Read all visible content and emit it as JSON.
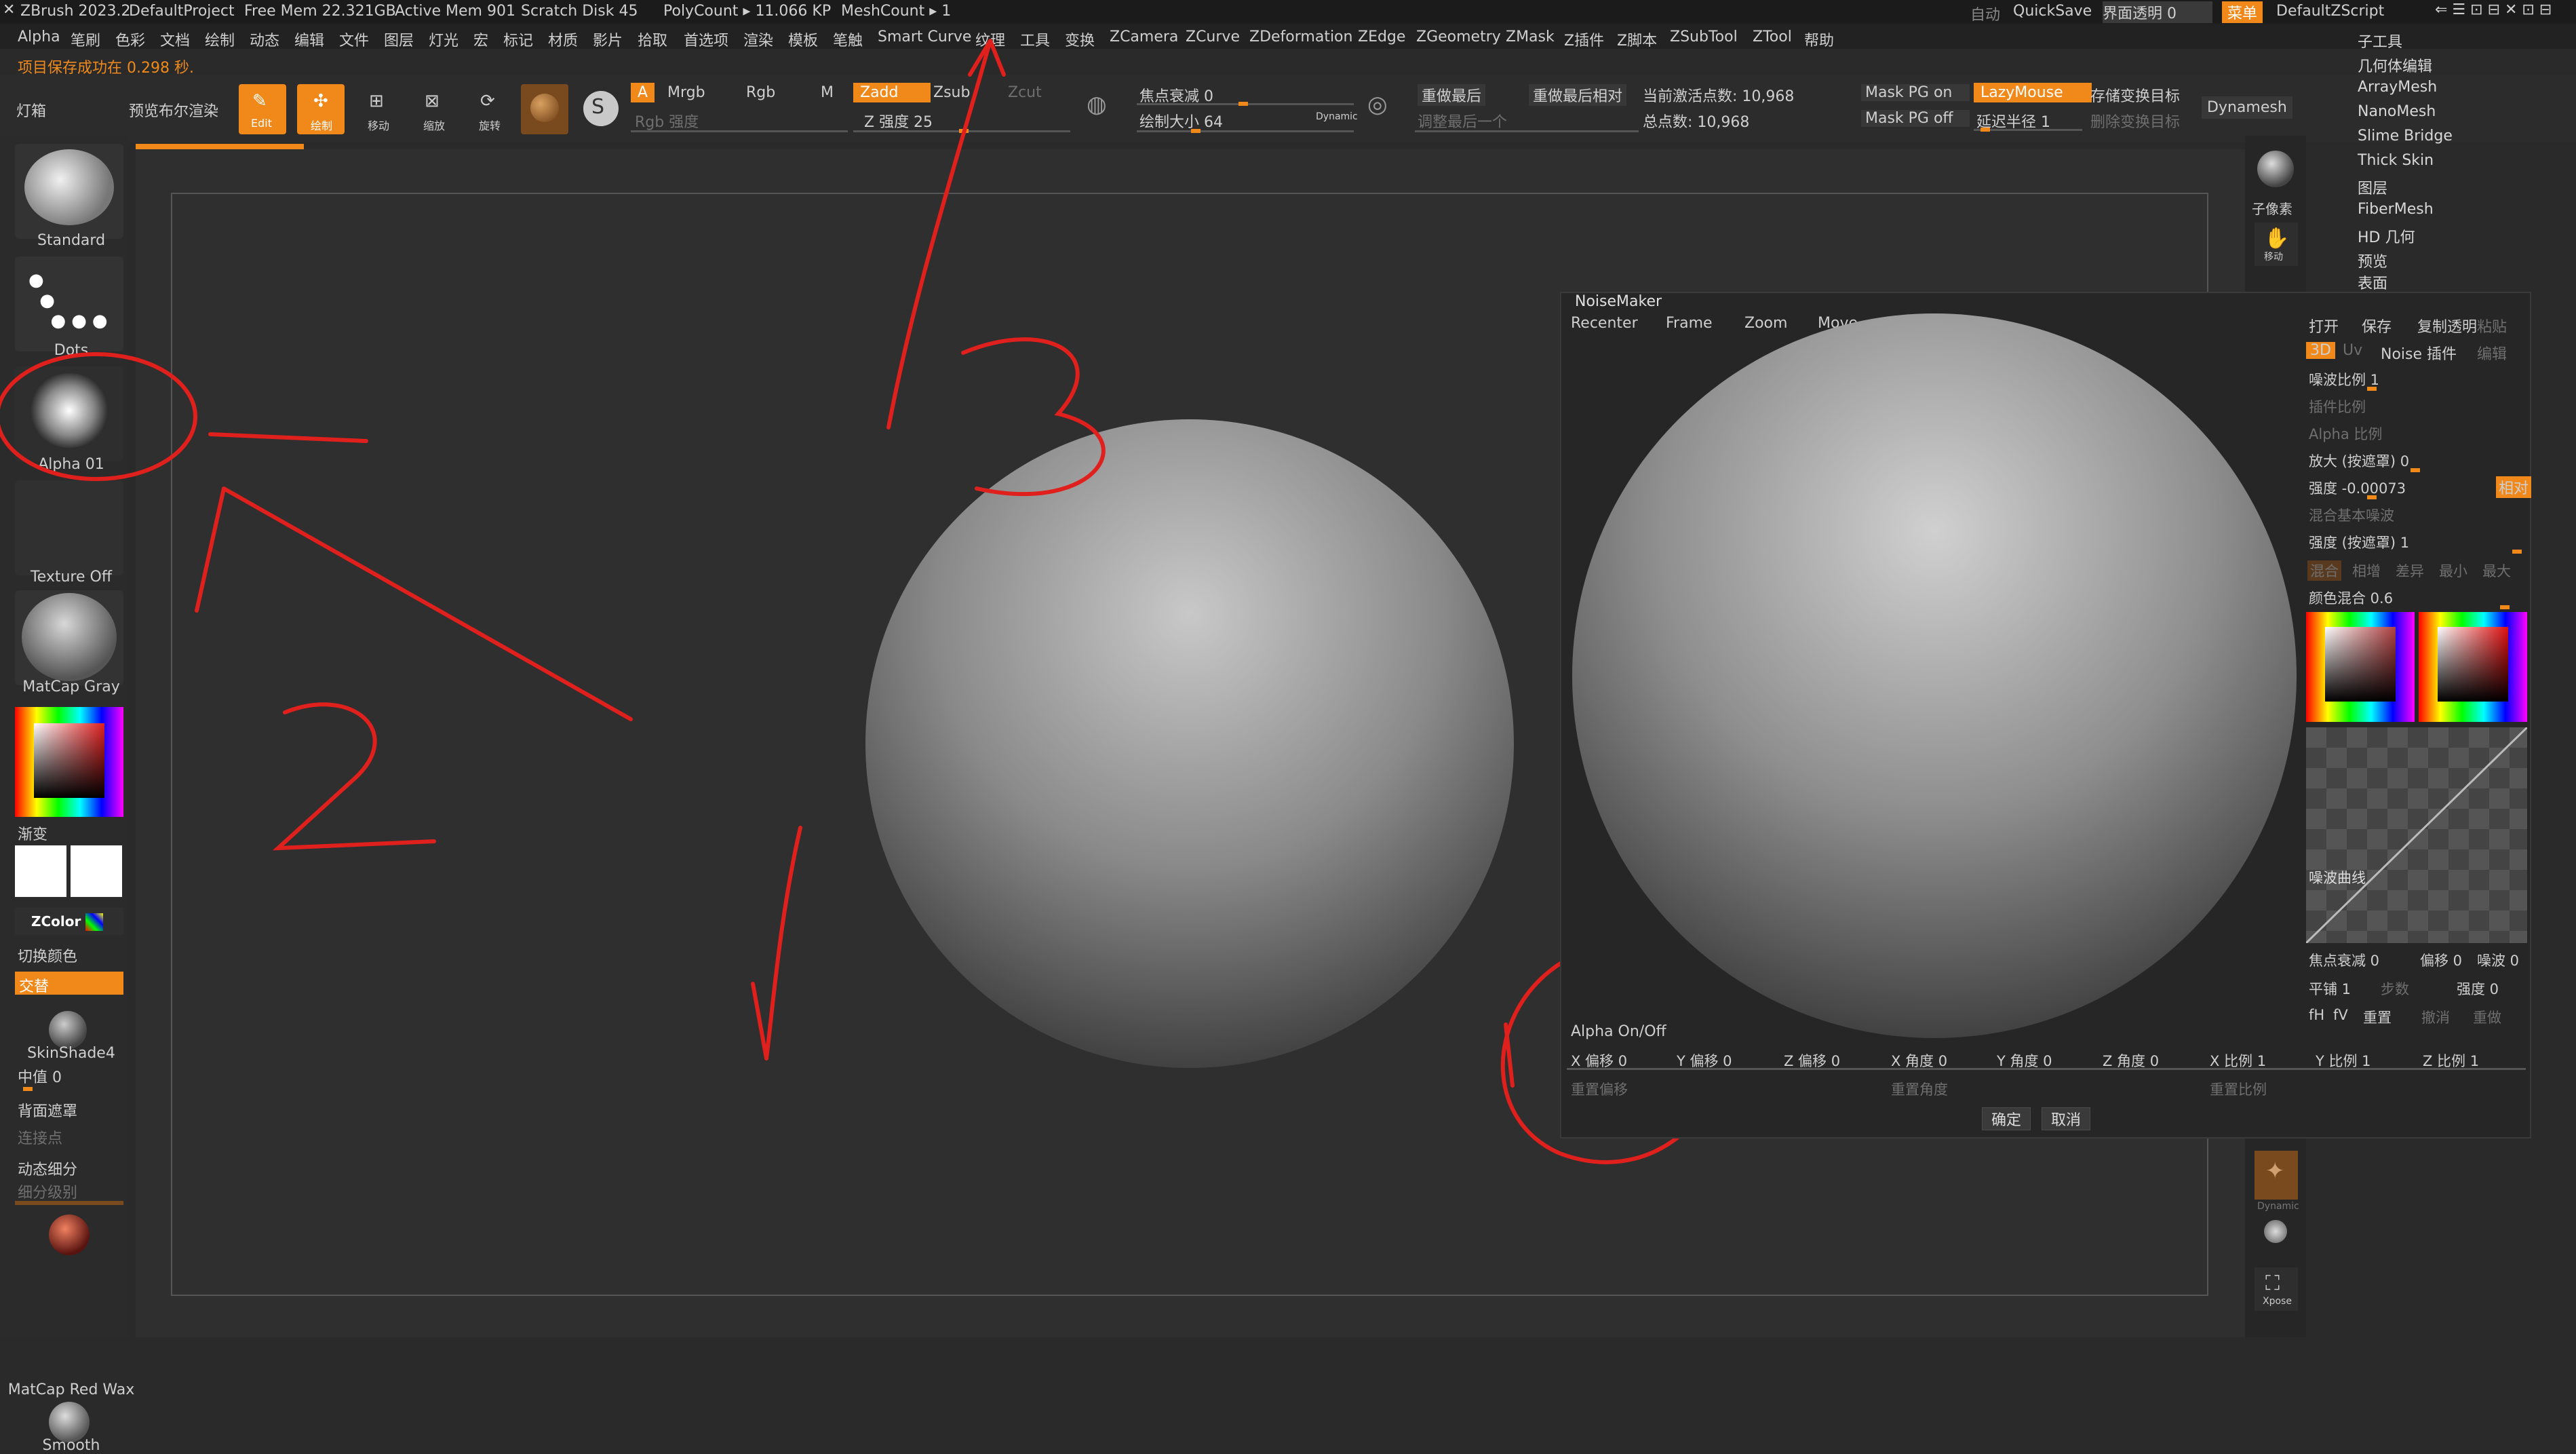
{
  "window": {
    "app_title": "ZBrush 2023.2",
    "project": "DefaultProject",
    "free_mem": "Free Mem 22.321GB",
    "active_mem": "Active Mem 901",
    "scratch_disk": "Scratch Disk 45",
    "polycount": "PolyCount ▸ 11.066 KP",
    "meshcount": "MeshCount ▸ 1",
    "auto_label": "自动",
    "quicksave": "QuickSave",
    "ui_transparency": "界面透明 0",
    "menu_btn": "菜单",
    "default_script": "DefaultZScript"
  },
  "menus": [
    "Alpha",
    "笔刷",
    "色彩",
    "文档",
    "绘制",
    "动态",
    "编辑",
    "文件",
    "图层",
    "灯光",
    "宏",
    "标记",
    "材质",
    "影片",
    "拾取",
    "首选项",
    "渲染",
    "模板",
    "笔触",
    "Smart Curve",
    "纹理",
    "工具",
    "变换",
    "ZCamera",
    "ZCurve",
    "ZDeformation",
    "ZEdge",
    "ZGeometry",
    "ZMask",
    "Z插件",
    "Z脚本",
    "ZSubTool",
    "ZTool",
    "帮助"
  ],
  "status": {
    "saved_msg": "项目保存成功在 0.298 秒."
  },
  "toolbar": {
    "light_box": "灯箱",
    "bpr": "预览布尔渲染",
    "edit": "Edit",
    "draw": "绘制",
    "move": "移动",
    "scale": "缩放",
    "rotate": "旋转",
    "a_btn": "A",
    "mrgb": "Mrgb",
    "rgb": "Rgb",
    "m": "M",
    "rgb_intensity": "Rgb 强度",
    "zadd": "Zadd",
    "zsub": "Zsub",
    "zcut": "Zcut",
    "z_intensity": "Z 强度 25",
    "focal_shift": "焦点衰减 0",
    "draw_size": "绘制大小 64",
    "dynamic": "Dynamic",
    "redo_last": "重做最后",
    "redo_last_rel": "重做最后相对",
    "adjust_last": "调整最后一个",
    "active_points": "当前激活点数: 10,968",
    "total_points": "总点数: 10,968",
    "mask_pg_on": "Mask PG on",
    "mask_pg_off": "Mask PG off",
    "lazymouse": "LazyMouse",
    "lazy_radius": "延迟半径 1",
    "store_morph": "存储变换目标",
    "delete_morph": "删除变换目标",
    "dynamesh": "Dynamesh"
  },
  "left_panel": {
    "brush": "Standard",
    "stroke": "Dots",
    "alpha": "Alpha 01",
    "texture": "Texture Off",
    "material": "MatCap Gray",
    "gradient": "渐变",
    "zcolor": "ZColor",
    "switch_color": "切换颜色",
    "alternate": "交替",
    "skinshade": "SkinShade4",
    "midvalue": "中值 0",
    "backface": "背面遮罩",
    "connect_points": "连接点",
    "dynamic_subdiv": "动态细分",
    "subdiv_level": "细分级别",
    "matcap_red": "MatCap Red Wax",
    "smooth": "Smooth"
  },
  "right_bar": {
    "subpixel": "子像素",
    "dynamic": "Dynamic",
    "xpose": "Xpose",
    "move_label": "移动"
  },
  "right_menu": [
    "子工具",
    "几何体编辑",
    "ArrayMesh",
    "NanoMesh",
    "Slime Bridge",
    "Thick Skin",
    "图层",
    "FiberMesh",
    "HD 几何",
    "预览",
    "表面"
  ],
  "noisemaker": {
    "title": "NoiseMaker",
    "top_buttons": [
      "Recenter",
      "Frame",
      "Zoom",
      "Move"
    ],
    "open": "打开",
    "save": "保存",
    "copy": "复制透明",
    "paste": "粘贴",
    "mode_3d": "3D",
    "mode_uv": "Uv",
    "noise_plugin": "Noise 插件",
    "edit": "编辑",
    "noise_scale": "噪波比例 1",
    "plugin_scale": "插件比例",
    "alpha_scale": "Alpha 比例",
    "magnify": "放大 (按遮罩) 0",
    "strength": "强度 -0.00073",
    "relative": "相对",
    "mix_base": "混合基本噪波",
    "strength_mask": "强度 (按遮罩) 1",
    "blend_tabs": [
      "混合",
      "相增",
      "差异",
      "最小",
      "最大"
    ],
    "color_blend": "颜色混合 0.6",
    "noise_curve": "噪波曲线",
    "focal_shift": "焦点衰减 0",
    "offset": "偏移 0",
    "noise": "噪波 0",
    "tile": "平铺 1",
    "steps": "步数",
    "strength2": "强度 0",
    "fh": "fH",
    "fv": "fV",
    "reset": "重置",
    "undo": "撤消",
    "redo": "重做",
    "alpha_onoff": "Alpha On/Off",
    "x_offset": "X 偏移 0",
    "y_offset": "Y 偏移 0",
    "z_offset": "Z 偏移 0",
    "x_angle": "X 角度 0",
    "y_angle": "Y 角度 0",
    "z_angle": "Z 角度 0",
    "x_scale": "X 比例 1",
    "y_scale": "Y 比例 1",
    "z_scale": "Z 比例 1",
    "reset_offset": "重置偏移",
    "reset_angle": "重置角度",
    "reset_scale": "重置比例",
    "ok": "确定",
    "cancel": "取消"
  },
  "colors": {
    "accent": "#f0891a",
    "annotation": "#e0201c"
  }
}
